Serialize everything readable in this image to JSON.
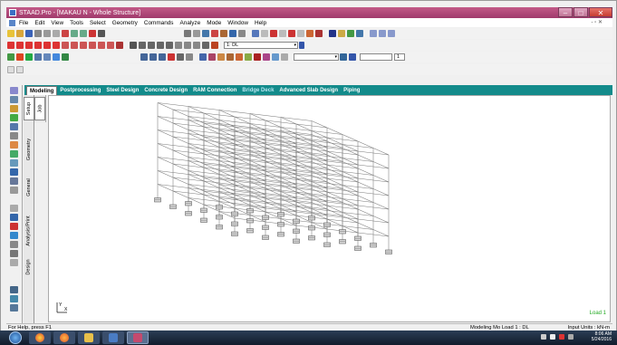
{
  "window": {
    "title": "STAAD.Pro - [MAKAU N - Whole Structure]",
    "buttons": [
      "–",
      "□",
      "✕"
    ],
    "mdi_buttons": "- ▫ ✕"
  },
  "menu": [
    "File",
    "Edit",
    "View",
    "Tools",
    "Select",
    "Geometry",
    "Commands",
    "Analyze",
    "Mode",
    "Window",
    "Help"
  ],
  "toolbar": {
    "load_case_select": "1: DL",
    "numeric_box": "1",
    "help_icon": "?"
  },
  "tabs": [
    {
      "label": "Modeling",
      "active": true
    },
    {
      "label": "Postprocessing",
      "active": false
    },
    {
      "label": "Steel Design",
      "active": false
    },
    {
      "label": "Concrete Design",
      "active": false
    },
    {
      "label": "RAM Connection",
      "active": false
    },
    {
      "label": "Bridge Deck",
      "active": false,
      "highlight": true
    },
    {
      "label": "Advanced Slab Design",
      "active": false
    },
    {
      "label": "Piping",
      "active": false
    }
  ],
  "side_tabs": [
    "Setup",
    "Geometry",
    "General",
    "Analysis/Print",
    "Design"
  ],
  "job_tab": "Job",
  "viewport": {
    "load_label": "Load 1",
    "axis_y": "Y",
    "axis_x": "X"
  },
  "status": {
    "help": "For Help, press F1",
    "mode": "Modeling Mo",
    "load": "Load 1 : DL",
    "units": "Input Units : kN-m"
  },
  "taskbar": {
    "time": "8:06 AM",
    "date": "5/24/2016"
  },
  "colors": {
    "titlebar": "#a03a6c",
    "tabbar": "#138b8b",
    "load_label": "#22aa22",
    "taskbar": "#1b2a40"
  }
}
